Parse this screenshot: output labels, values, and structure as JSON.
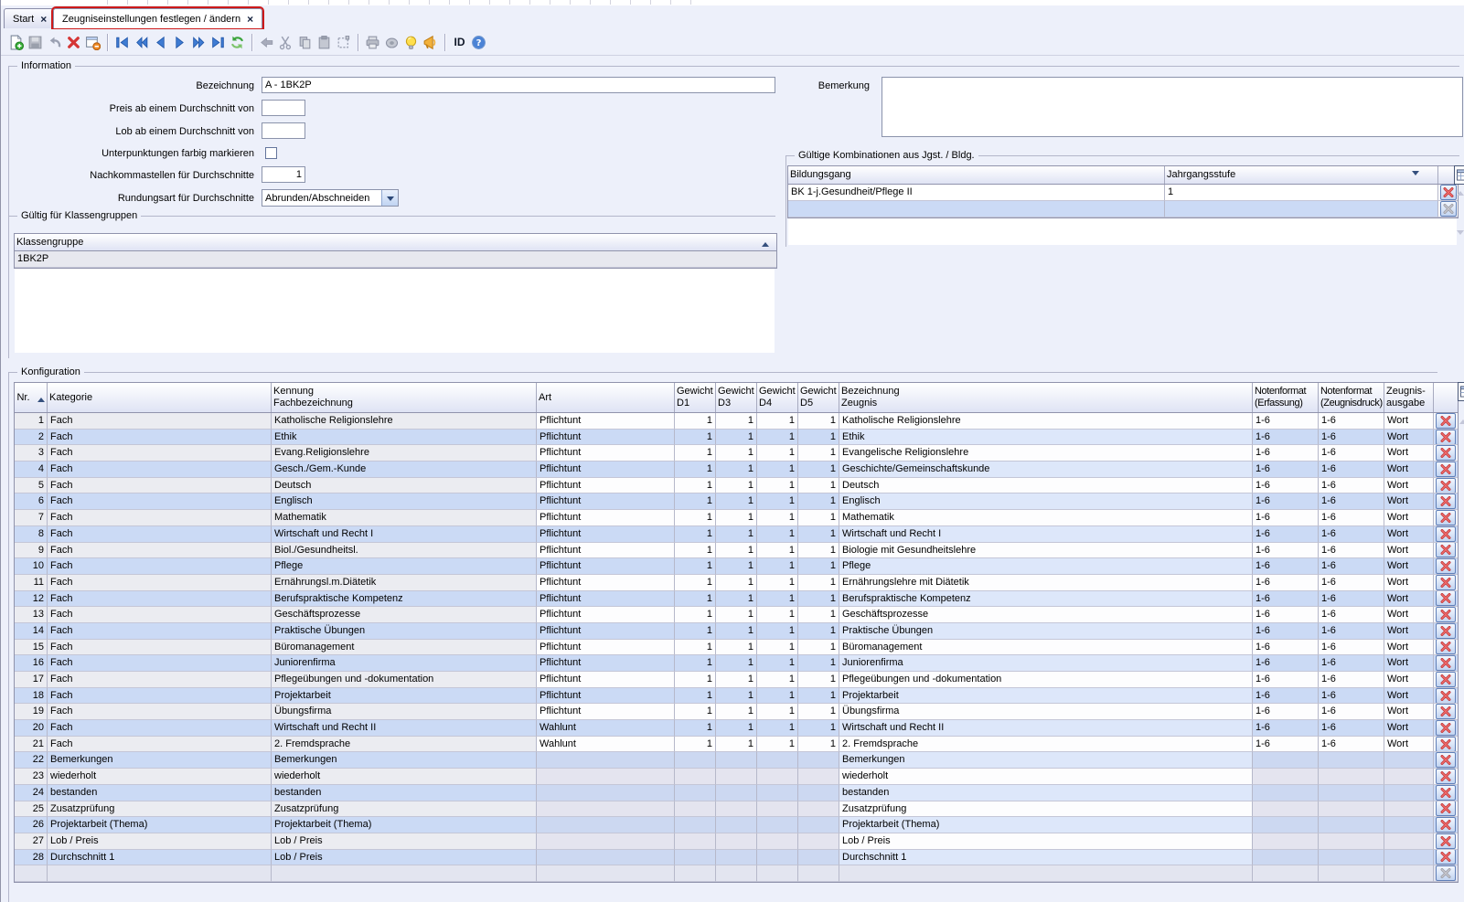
{
  "tabs": [
    {
      "label": "Start",
      "close_glyph": "×",
      "active": false
    },
    {
      "label": "Zeugniseinstellungen festlegen / ändern",
      "close_glyph": "×",
      "active": true
    }
  ],
  "toolbar": {
    "id_label": "ID",
    "groups": [
      [
        {
          "name": "new-document",
          "enabled": true
        },
        {
          "name": "save",
          "enabled": false
        },
        {
          "name": "undo",
          "enabled": false
        },
        {
          "name": "delete",
          "enabled": true
        },
        {
          "name": "remove-form",
          "enabled": true
        }
      ],
      [
        {
          "name": "nav-first",
          "enabled": true
        },
        {
          "name": "nav-fast-back",
          "enabled": true
        },
        {
          "name": "nav-back",
          "enabled": true
        },
        {
          "name": "nav-forward",
          "enabled": true
        },
        {
          "name": "nav-fast-forward",
          "enabled": true
        },
        {
          "name": "nav-last",
          "enabled": true
        },
        {
          "name": "refresh",
          "enabled": true
        }
      ],
      [
        {
          "name": "arrow-left",
          "enabled": false
        },
        {
          "name": "cut",
          "enabled": false
        },
        {
          "name": "copy",
          "enabled": false
        },
        {
          "name": "paste",
          "enabled": false
        },
        {
          "name": "select-region",
          "enabled": false
        }
      ],
      [
        {
          "name": "print",
          "enabled": false
        },
        {
          "name": "record",
          "enabled": false
        },
        {
          "name": "hint-bulb",
          "enabled": true
        },
        {
          "name": "notification-horn",
          "enabled": true
        }
      ],
      [
        {
          "name": "id-button",
          "enabled": true
        },
        {
          "name": "help",
          "enabled": true
        }
      ]
    ]
  },
  "colors": {
    "accent_red": "#cd1a1a",
    "row_even": "#cbdaf5",
    "row_odd": "#ebecf1",
    "header_grad_bottom": "#dfe3f4",
    "panel": "#edf0fa"
  },
  "information": {
    "title": "Information",
    "bezeichnung": {
      "label": "Bezeichnung",
      "value": "A - 1BK2P"
    },
    "preis": {
      "label": "Preis ab einem Durchschnitt von",
      "value": ""
    },
    "lob": {
      "label": "Lob ab einem Durchschnitt von",
      "value": ""
    },
    "unterpunktungen": {
      "label": "Unterpunktungen farbig markieren",
      "checked": false
    },
    "nachkommastellen": {
      "label": "Nachkommastellen für Durchschnitte",
      "value": "1"
    },
    "rundungsart": {
      "label": "Rundungsart für Durchschnitte",
      "value": "Abrunden/Abschneiden"
    },
    "bemerkung": {
      "label": "Bemerkung",
      "value": ""
    }
  },
  "kombinationen": {
    "title": "Gültige Kombinationen aus Jgst. / Bldg.",
    "columns": [
      "Bildungsgang",
      "Jahrgangsstufe"
    ],
    "rows": [
      {
        "bildungsgang": "BK 1-j.Gesundheit/Pflege II",
        "jahrgangsstufe": "1"
      }
    ]
  },
  "klassengruppen": {
    "title": "Gültig für Klassengruppen",
    "column": "Klassengruppe",
    "rows": [
      "1BK2P"
    ]
  },
  "konfiguration": {
    "title": "Konfiguration",
    "columns": [
      [
        "Nr.",
        ""
      ],
      [
        "Kategorie",
        ""
      ],
      [
        "Kennung",
        "Fachbezeichnung"
      ],
      [
        "Art",
        ""
      ],
      [
        "Gewicht",
        "D1"
      ],
      [
        "Gewicht",
        "D3"
      ],
      [
        "Gewicht",
        "D4"
      ],
      [
        "Gewicht",
        "D5"
      ],
      [
        "Bezeichnung",
        "Zeugnis"
      ],
      [
        "Notenformat",
        "(Erfassung)"
      ],
      [
        "Notenformat",
        "(Zeugnisdruck)"
      ],
      [
        "Zeugnis-",
        "ausgabe"
      ]
    ],
    "rows": [
      {
        "nr": "1",
        "kategorie": "Fach",
        "kennung": "Katholische Religionslehre",
        "art": "Pflichtunt",
        "d1": "1",
        "d3": "1",
        "d4": "1",
        "d5": "1",
        "zeugnis": "Katholische Religionslehre",
        "nf_erfassung": "1-6",
        "nf_zeugnisdruck": "1-6",
        "ausgabe": "Wort"
      },
      {
        "nr": "2",
        "kategorie": "Fach",
        "kennung": "Ethik",
        "art": "Pflichtunt",
        "d1": "1",
        "d3": "1",
        "d4": "1",
        "d5": "1",
        "zeugnis": "Ethik",
        "nf_erfassung": "1-6",
        "nf_zeugnisdruck": "1-6",
        "ausgabe": "Wort"
      },
      {
        "nr": "3",
        "kategorie": "Fach",
        "kennung": "Evang.Religionslehre",
        "art": "Pflichtunt",
        "d1": "1",
        "d3": "1",
        "d4": "1",
        "d5": "1",
        "zeugnis": "Evangelische Religionslehre",
        "nf_erfassung": "1-6",
        "nf_zeugnisdruck": "1-6",
        "ausgabe": "Wort"
      },
      {
        "nr": "4",
        "kategorie": "Fach",
        "kennung": "Gesch./Gem.-Kunde",
        "art": "Pflichtunt",
        "d1": "1",
        "d3": "1",
        "d4": "1",
        "d5": "1",
        "zeugnis": "Geschichte/Gemeinschaftskunde",
        "nf_erfassung": "1-6",
        "nf_zeugnisdruck": "1-6",
        "ausgabe": "Wort"
      },
      {
        "nr": "5",
        "kategorie": "Fach",
        "kennung": "Deutsch",
        "art": "Pflichtunt",
        "d1": "1",
        "d3": "1",
        "d4": "1",
        "d5": "1",
        "zeugnis": "Deutsch",
        "nf_erfassung": "1-6",
        "nf_zeugnisdruck": "1-6",
        "ausgabe": "Wort"
      },
      {
        "nr": "6",
        "kategorie": "Fach",
        "kennung": "Englisch",
        "art": "Pflichtunt",
        "d1": "1",
        "d3": "1",
        "d4": "1",
        "d5": "1",
        "zeugnis": "Englisch",
        "nf_erfassung": "1-6",
        "nf_zeugnisdruck": "1-6",
        "ausgabe": "Wort"
      },
      {
        "nr": "7",
        "kategorie": "Fach",
        "kennung": "Mathematik",
        "art": "Pflichtunt",
        "d1": "1",
        "d3": "1",
        "d4": "1",
        "d5": "1",
        "zeugnis": "Mathematik",
        "nf_erfassung": "1-6",
        "nf_zeugnisdruck": "1-6",
        "ausgabe": "Wort"
      },
      {
        "nr": "8",
        "kategorie": "Fach",
        "kennung": "Wirtschaft und Recht I",
        "art": "Pflichtunt",
        "d1": "1",
        "d3": "1",
        "d4": "1",
        "d5": "1",
        "zeugnis": "Wirtschaft und Recht I",
        "nf_erfassung": "1-6",
        "nf_zeugnisdruck": "1-6",
        "ausgabe": "Wort"
      },
      {
        "nr": "9",
        "kategorie": "Fach",
        "kennung": "Biol./Gesundheitsl.",
        "art": "Pflichtunt",
        "d1": "1",
        "d3": "1",
        "d4": "1",
        "d5": "1",
        "zeugnis": "Biologie mit Gesundheitslehre",
        "nf_erfassung": "1-6",
        "nf_zeugnisdruck": "1-6",
        "ausgabe": "Wort"
      },
      {
        "nr": "10",
        "kategorie": "Fach",
        "kennung": "Pflege",
        "art": "Pflichtunt",
        "d1": "1",
        "d3": "1",
        "d4": "1",
        "d5": "1",
        "zeugnis": "Pflege",
        "nf_erfassung": "1-6",
        "nf_zeugnisdruck": "1-6",
        "ausgabe": "Wort"
      },
      {
        "nr": "11",
        "kategorie": "Fach",
        "kennung": "Ernährungsl.m.Diätetik",
        "art": "Pflichtunt",
        "d1": "1",
        "d3": "1",
        "d4": "1",
        "d5": "1",
        "zeugnis": "Ernährungslehre mit Diätetik",
        "nf_erfassung": "1-6",
        "nf_zeugnisdruck": "1-6",
        "ausgabe": "Wort"
      },
      {
        "nr": "12",
        "kategorie": "Fach",
        "kennung": "Berufspraktische Kompetenz",
        "art": "Pflichtunt",
        "d1": "1",
        "d3": "1",
        "d4": "1",
        "d5": "1",
        "zeugnis": "Berufspraktische Kompetenz",
        "nf_erfassung": "1-6",
        "nf_zeugnisdruck": "1-6",
        "ausgabe": "Wort"
      },
      {
        "nr": "13",
        "kategorie": "Fach",
        "kennung": "Geschäftsprozesse",
        "art": "Pflichtunt",
        "d1": "1",
        "d3": "1",
        "d4": "1",
        "d5": "1",
        "zeugnis": "Geschäftsprozesse",
        "nf_erfassung": "1-6",
        "nf_zeugnisdruck": "1-6",
        "ausgabe": "Wort"
      },
      {
        "nr": "14",
        "kategorie": "Fach",
        "kennung": "Praktische Übungen",
        "art": "Pflichtunt",
        "d1": "1",
        "d3": "1",
        "d4": "1",
        "d5": "1",
        "zeugnis": "Praktische Übungen",
        "nf_erfassung": "1-6",
        "nf_zeugnisdruck": "1-6",
        "ausgabe": "Wort"
      },
      {
        "nr": "15",
        "kategorie": "Fach",
        "kennung": "Büromanagement",
        "art": "Pflichtunt",
        "d1": "1",
        "d3": "1",
        "d4": "1",
        "d5": "1",
        "zeugnis": "Büromanagement",
        "nf_erfassung": "1-6",
        "nf_zeugnisdruck": "1-6",
        "ausgabe": "Wort"
      },
      {
        "nr": "16",
        "kategorie": "Fach",
        "kennung": "Juniorenfirma",
        "art": "Pflichtunt",
        "d1": "1",
        "d3": "1",
        "d4": "1",
        "d5": "1",
        "zeugnis": "Juniorenfirma",
        "nf_erfassung": "1-6",
        "nf_zeugnisdruck": "1-6",
        "ausgabe": "Wort"
      },
      {
        "nr": "17",
        "kategorie": "Fach",
        "kennung": "Pflegeübungen und -dokumentation",
        "art": "Pflichtunt",
        "d1": "1",
        "d3": "1",
        "d4": "1",
        "d5": "1",
        "zeugnis": "Pflegeübungen und -dokumentation",
        "nf_erfassung": "1-6",
        "nf_zeugnisdruck": "1-6",
        "ausgabe": "Wort"
      },
      {
        "nr": "18",
        "kategorie": "Fach",
        "kennung": "Projektarbeit",
        "art": "Pflichtunt",
        "d1": "1",
        "d3": "1",
        "d4": "1",
        "d5": "1",
        "zeugnis": "Projektarbeit",
        "nf_erfassung": "1-6",
        "nf_zeugnisdruck": "1-6",
        "ausgabe": "Wort"
      },
      {
        "nr": "19",
        "kategorie": "Fach",
        "kennung": "Übungsfirma",
        "art": "Pflichtunt",
        "d1": "1",
        "d3": "1",
        "d4": "1",
        "d5": "1",
        "zeugnis": "Übungsfirma",
        "nf_erfassung": "1-6",
        "nf_zeugnisdruck": "1-6",
        "ausgabe": "Wort"
      },
      {
        "nr": "20",
        "kategorie": "Fach",
        "kennung": "Wirtschaft und Recht II",
        "art": "Wahlunt",
        "d1": "1",
        "d3": "1",
        "d4": "1",
        "d5": "1",
        "zeugnis": "Wirtschaft und Recht II",
        "nf_erfassung": "1-6",
        "nf_zeugnisdruck": "1-6",
        "ausgabe": "Wort"
      },
      {
        "nr": "21",
        "kategorie": "Fach",
        "kennung": "2. Fremdsprache",
        "art": "Wahlunt",
        "d1": "1",
        "d3": "1",
        "d4": "1",
        "d5": "1",
        "zeugnis": "2. Fremdsprache",
        "nf_erfassung": "1-6",
        "nf_zeugnisdruck": "1-6",
        "ausgabe": "Wort"
      },
      {
        "nr": "22",
        "kategorie": "Bemerkungen",
        "kennung": "Bemerkungen",
        "art": "",
        "d1": "",
        "d3": "",
        "d4": "",
        "d5": "",
        "zeugnis": "Bemerkungen",
        "nf_erfassung": "",
        "nf_zeugnisdruck": "",
        "ausgabe": ""
      },
      {
        "nr": "23",
        "kategorie": "wiederholt",
        "kennung": "wiederholt",
        "art": "",
        "d1": "",
        "d3": "",
        "d4": "",
        "d5": "",
        "zeugnis": "wiederholt",
        "nf_erfassung": "",
        "nf_zeugnisdruck": "",
        "ausgabe": ""
      },
      {
        "nr": "24",
        "kategorie": "bestanden",
        "kennung": "bestanden",
        "art": "",
        "d1": "",
        "d3": "",
        "d4": "",
        "d5": "",
        "zeugnis": "bestanden",
        "nf_erfassung": "",
        "nf_zeugnisdruck": "",
        "ausgabe": ""
      },
      {
        "nr": "25",
        "kategorie": "Zusatzprüfung",
        "kennung": "Zusatzprüfung",
        "art": "",
        "d1": "",
        "d3": "",
        "d4": "",
        "d5": "",
        "zeugnis": "Zusatzprüfung",
        "nf_erfassung": "",
        "nf_zeugnisdruck": "",
        "ausgabe": ""
      },
      {
        "nr": "26",
        "kategorie": "Projektarbeit (Thema)",
        "kennung": "Projektarbeit (Thema)",
        "art": "",
        "d1": "",
        "d3": "",
        "d4": "",
        "d5": "",
        "zeugnis": "Projektarbeit (Thema)",
        "nf_erfassung": "",
        "nf_zeugnisdruck": "",
        "ausgabe": ""
      },
      {
        "nr": "27",
        "kategorie": "Lob / Preis",
        "kennung": "Lob / Preis",
        "art": "",
        "d1": "",
        "d3": "",
        "d4": "",
        "d5": "",
        "zeugnis": "Lob / Preis",
        "nf_erfassung": "",
        "nf_zeugnisdruck": "",
        "ausgabe": ""
      },
      {
        "nr": "28",
        "kategorie": "Durchschnitt 1",
        "kennung": "Lob / Preis",
        "art": "",
        "d1": "",
        "d3": "",
        "d4": "",
        "d5": "",
        "zeugnis": "Durchschnitt 1",
        "nf_erfassung": "",
        "nf_zeugnisdruck": "",
        "ausgabe": ""
      }
    ]
  }
}
